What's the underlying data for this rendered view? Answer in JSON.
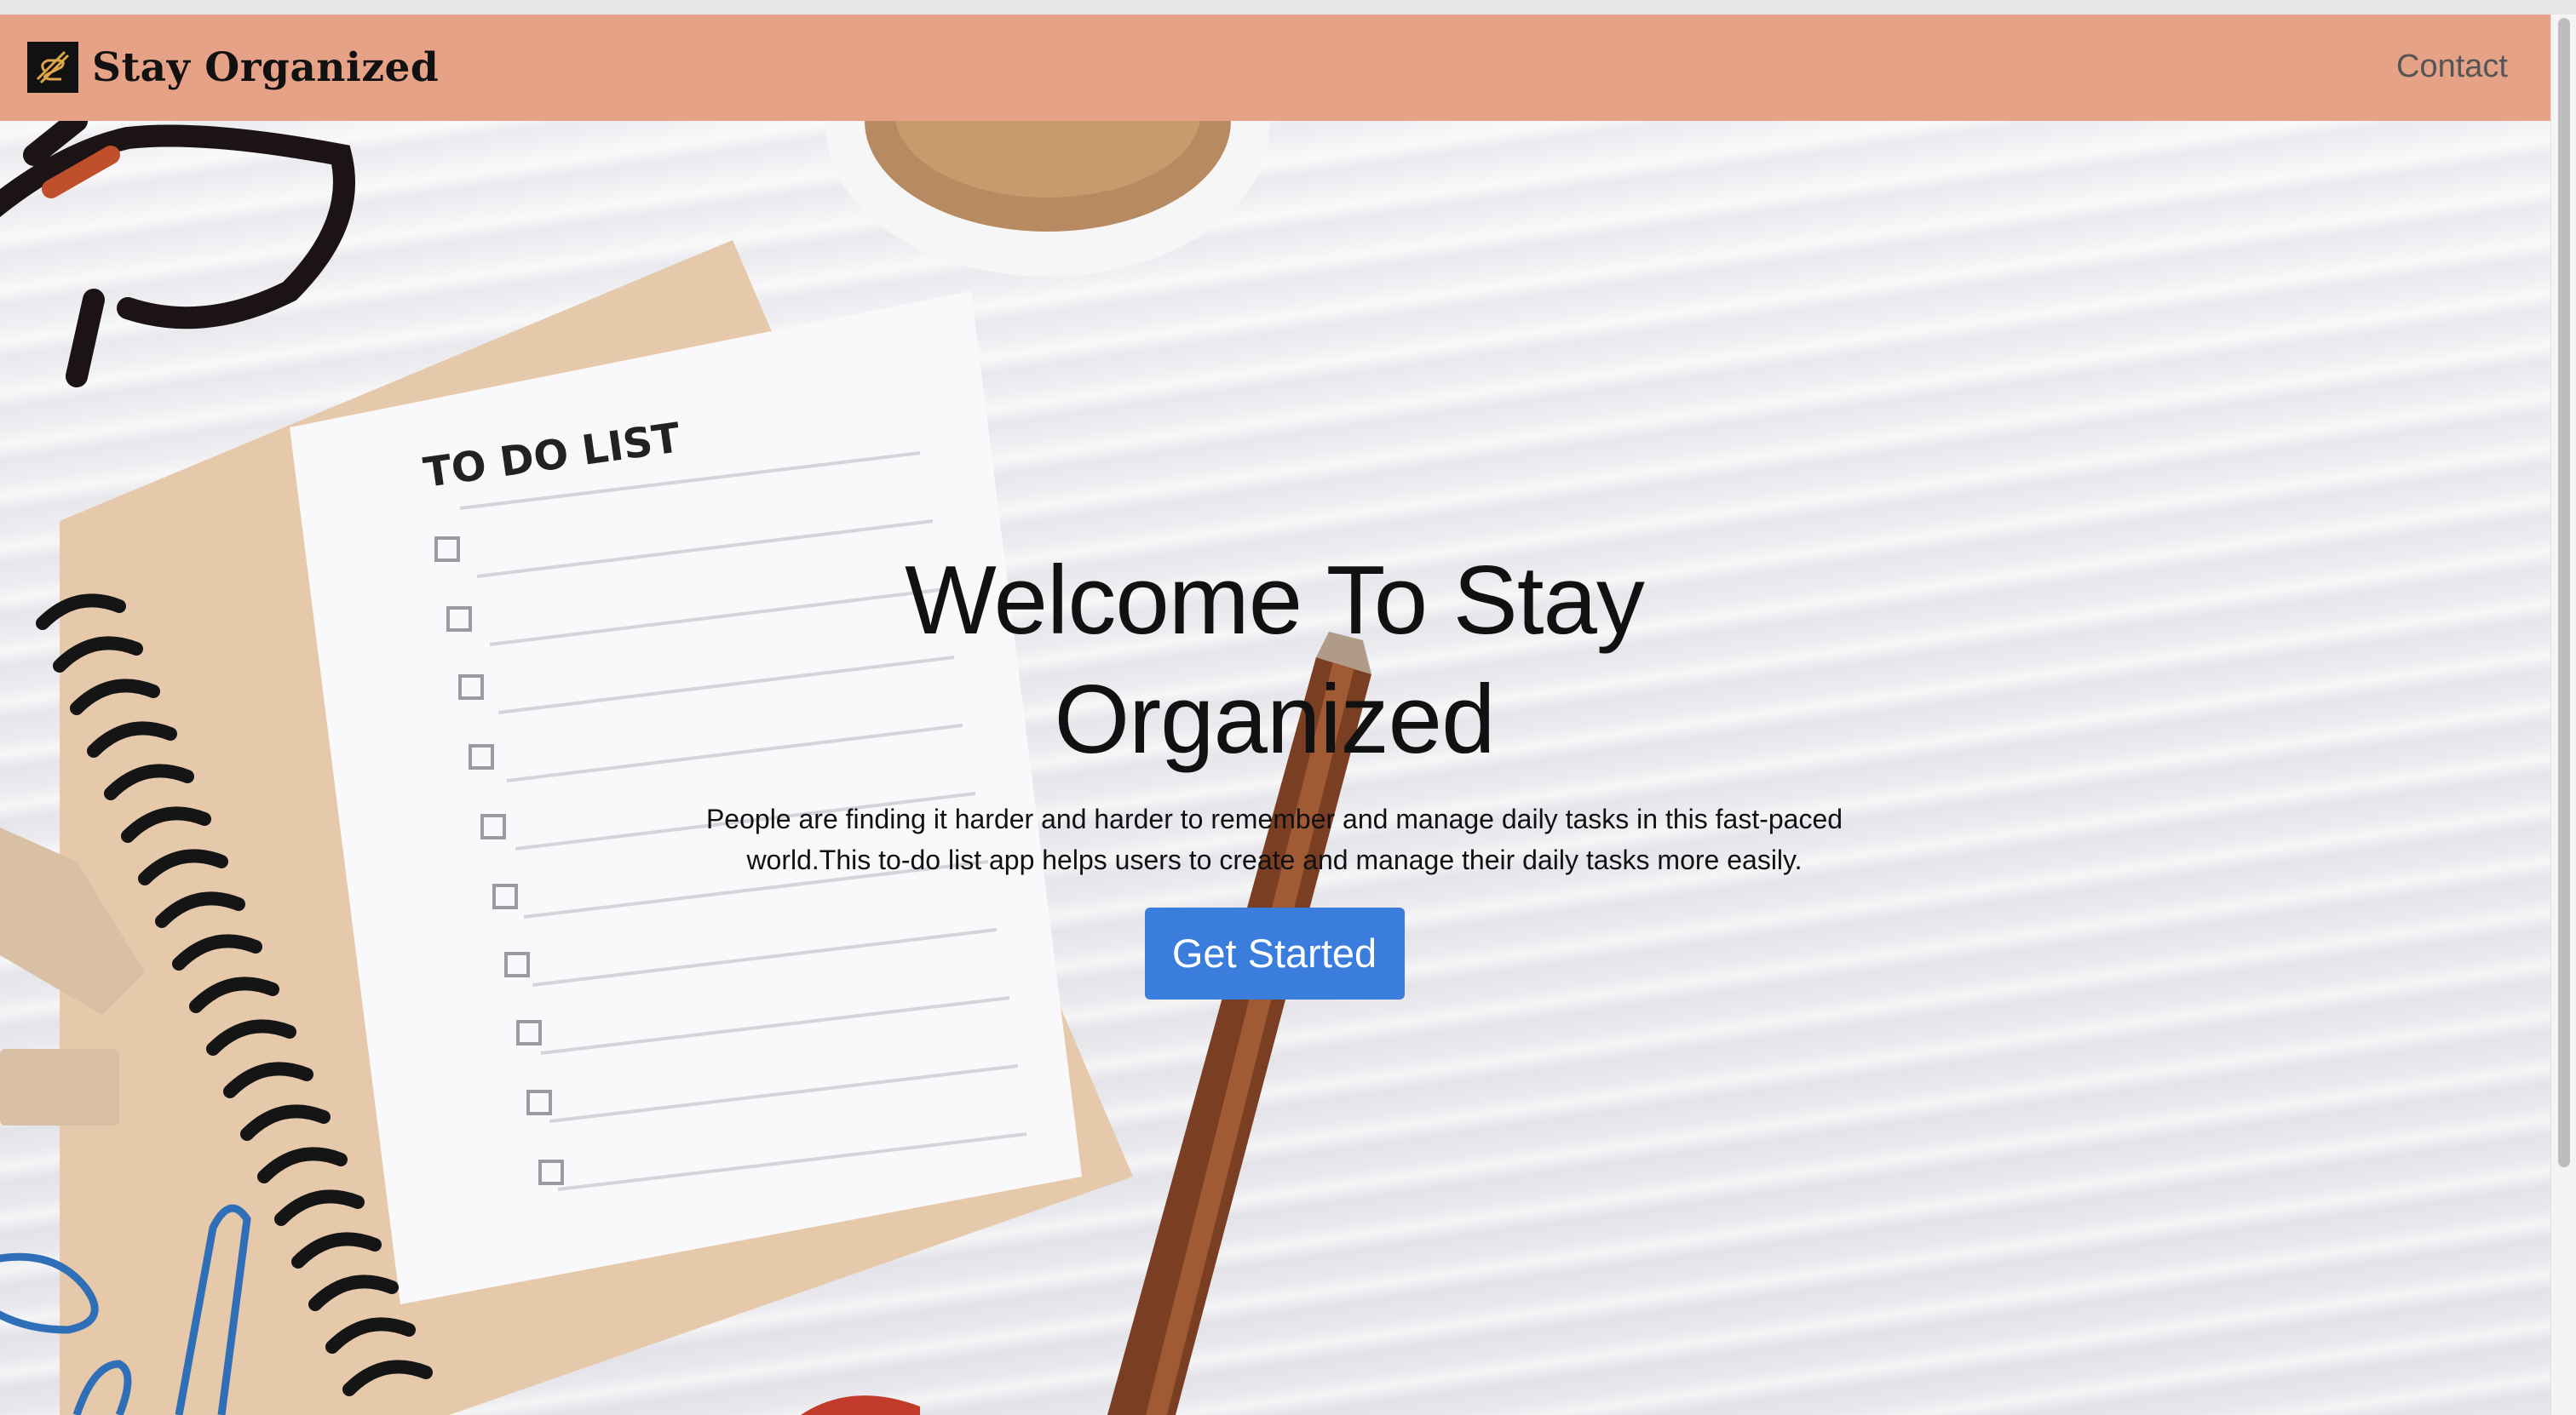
{
  "navbar": {
    "brand": "Stay Organized",
    "contact": "Contact",
    "logo_icon": "stay-organized-logo-icon"
  },
  "hero": {
    "title": "Welcome To Stay Organized",
    "description": "People are finding it harder and harder to remember and manage daily tasks in this fast-paced world.This to-do list app helps users to create and manage their daily tasks more easily.",
    "cta": "Get Started",
    "notepad_heading": "TO DO LIST"
  },
  "colors": {
    "navbar": "#e6a286",
    "button": "#3b7ddd"
  }
}
